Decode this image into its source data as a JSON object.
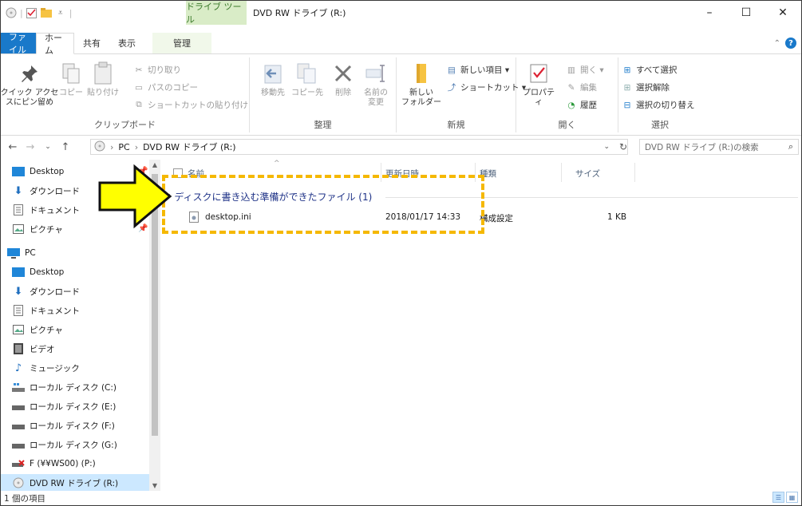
{
  "window": {
    "context_tab": "ドライブ ツール",
    "title": "DVD RW ドライブ (R:)",
    "controls": {
      "minimize": "–",
      "maximize": "☐",
      "close": "✕"
    }
  },
  "tabs": [
    {
      "label": "ファイル"
    },
    {
      "label": "ホーム"
    },
    {
      "label": "共有"
    },
    {
      "label": "表示"
    },
    {
      "label": "管理"
    }
  ],
  "ribbon": {
    "clipboard": {
      "label": "クリップボード",
      "pin": "クイック アクセ\nスにピン留め",
      "copy": "コピー",
      "paste": "貼り付け",
      "cut": "切り取り",
      "copy_path": "パスのコピー",
      "paste_shortcut": "ショートカットの貼り付け"
    },
    "organize": {
      "label": "整理",
      "move_to": "移動先",
      "copy_to": "コピー先",
      "delete": "削除",
      "rename": "名前の\n変更"
    },
    "new": {
      "label": "新規",
      "new_folder": "新しい\nフォルダー",
      "new_item": "新しい項目 ▾",
      "shortcut": "ショートカット ▾"
    },
    "open": {
      "label": "開く",
      "properties": "プロパティ",
      "open": "開く ▾",
      "edit": "編集",
      "history": "履歴"
    },
    "select": {
      "label": "選択",
      "select_all": "すべて選択",
      "select_none": "選択解除",
      "invert": "選択の切り替え"
    }
  },
  "address": {
    "path": [
      "PC",
      "DVD RW ドライブ (R:)"
    ],
    "search_placeholder": "DVD RW ドライブ (R:)の検索"
  },
  "nav": {
    "quick": [
      {
        "label": "Desktop",
        "icon": "desktop-folder-icon"
      },
      {
        "label": "ダウンロード",
        "icon": "download-icon"
      },
      {
        "label": "ドキュメント",
        "icon": "documents-icon"
      },
      {
        "label": "ピクチャ",
        "icon": "pictures-icon"
      }
    ],
    "pc_label": "PC",
    "pc": [
      {
        "label": "Desktop",
        "icon": "desktop-folder-icon"
      },
      {
        "label": "ダウンロード",
        "icon": "download-icon"
      },
      {
        "label": "ドキュメント",
        "icon": "documents-icon"
      },
      {
        "label": "ピクチャ",
        "icon": "pictures-icon"
      },
      {
        "label": "ビデオ",
        "icon": "video-icon"
      },
      {
        "label": "ミュージック",
        "icon": "music-icon"
      },
      {
        "label": "ローカル ディスク (C:)",
        "icon": "system-drive-icon"
      },
      {
        "label": "ローカル ディスク (E:)",
        "icon": "drive-icon"
      },
      {
        "label": "ローカル ディスク (F:)",
        "icon": "drive-icon"
      },
      {
        "label": "ローカル ディスク (G:)",
        "icon": "drive-icon"
      },
      {
        "label": "F (¥¥WS00) (P:)",
        "icon": "network-drive-disconnected-icon"
      },
      {
        "label": "DVD RW ドライブ (R:)",
        "icon": "dvd-drive-icon"
      }
    ]
  },
  "columns": {
    "name": "名前",
    "date": "更新日時",
    "type": "種類",
    "size": "サイズ"
  },
  "group": {
    "header": "ディスクに書き込む準備ができたファイル (1)"
  },
  "files": [
    {
      "name": "desktop.ini",
      "date": "2018/01/17 14:33",
      "type": "構成設定",
      "size": "1 KB"
    }
  ],
  "status": {
    "count": "1 個の項目"
  },
  "annotation": {
    "highlight_color": "#f5b800",
    "arrow_color": "#ffff00"
  }
}
